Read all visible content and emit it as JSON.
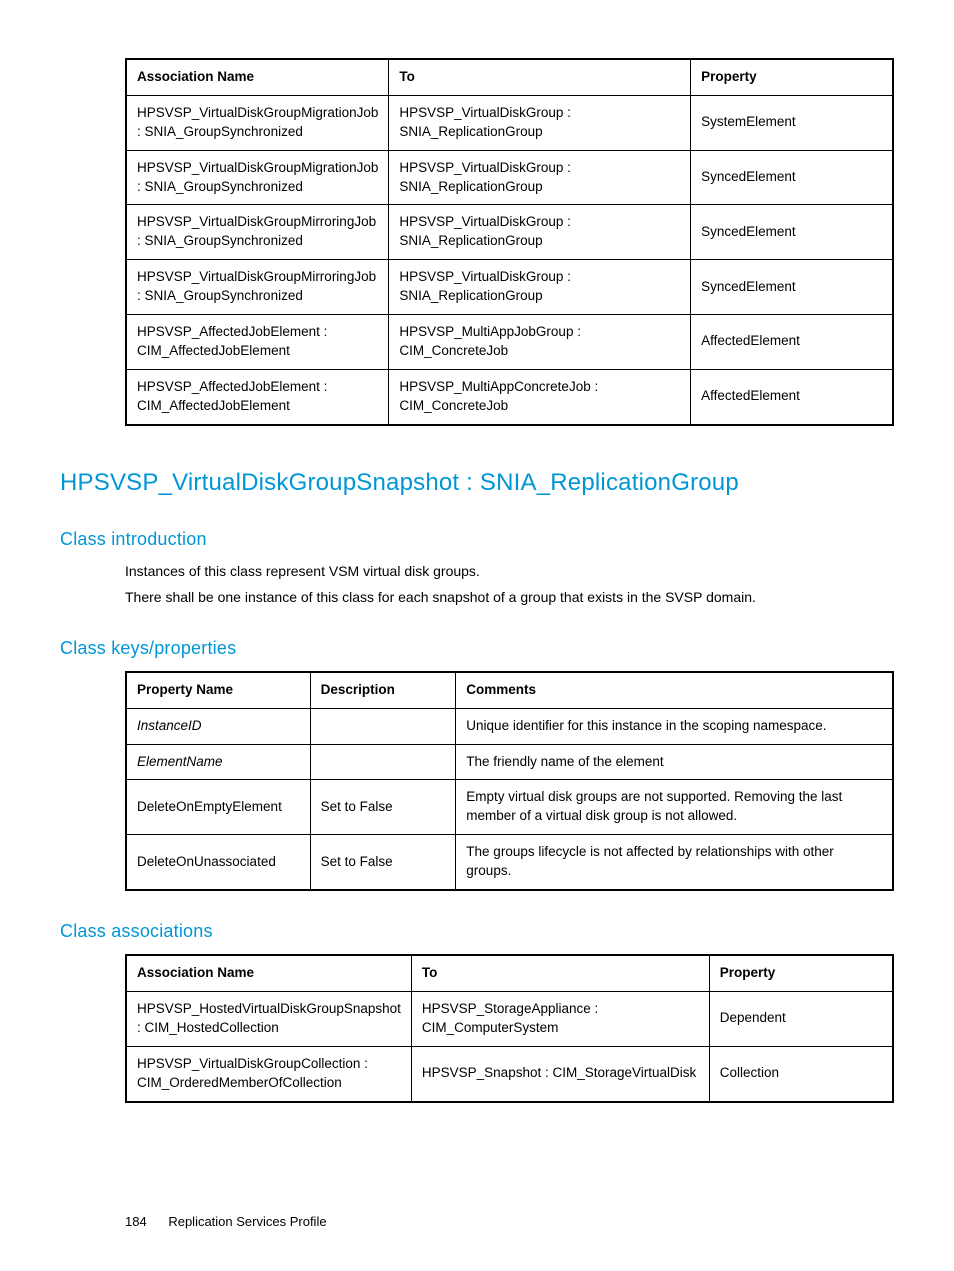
{
  "table1": {
    "headers": [
      "Association Name",
      "To",
      "Property"
    ],
    "rows": [
      [
        "HPSVSP_VirtualDiskGroupMigrationJob : SNIA_GroupSynchronized",
        "HPSVSP_VirtualDiskGroup : SNIA_ReplicationGroup",
        "SystemElement"
      ],
      [
        "HPSVSP_VirtualDiskGroupMigrationJob : SNIA_GroupSynchronized",
        "HPSVSP_VirtualDiskGroup : SNIA_ReplicationGroup",
        "SyncedElement"
      ],
      [
        "HPSVSP_VirtualDiskGroupMirroringJob : SNIA_GroupSynchronized",
        "HPSVSP_VirtualDiskGroup : SNIA_ReplicationGroup",
        "SyncedElement"
      ],
      [
        "HPSVSP_VirtualDiskGroupMirroringJob : SNIA_GroupSynchronized",
        "HPSVSP_VirtualDiskGroup : SNIA_ReplicationGroup",
        "SyncedElement"
      ],
      [
        "HPSVSP_AffectedJobElement : CIM_AffectedJobElement",
        "HPSVSP_MultiAppJobGroup : CIM_ConcreteJob",
        "AffectedElement"
      ],
      [
        "HPSVSP_AffectedJobElement : CIM_AffectedJobElement",
        "HPSVSP_MultiAppConcreteJob : CIM_ConcreteJob",
        "AffectedElement"
      ]
    ]
  },
  "heading1": "HPSVSP_VirtualDiskGroupSnapshot : SNIA_ReplicationGroup",
  "section_intro": {
    "title": "Class introduction",
    "p1": "Instances of this class represent VSM virtual disk groups.",
    "p2": "There shall be one instance of this class for each snapshot of a group that exists in the SVSP domain."
  },
  "section_keys": {
    "title": "Class keys/properties",
    "headers": [
      "Property Name",
      "Description",
      "Comments"
    ],
    "rows": [
      {
        "name": "InstanceID",
        "italic": true,
        "desc": "",
        "comments": "Unique identifier for this instance in the scoping namespace."
      },
      {
        "name": "ElementName",
        "italic": true,
        "desc": "",
        "comments": "The friendly name of the element"
      },
      {
        "name": "DeleteOnEmptyElement",
        "italic": false,
        "desc": "Set to False",
        "comments": "Empty virtual disk groups are not supported. Removing the last member of a virtual disk group is not allowed."
      },
      {
        "name": "DeleteOnUnassociated",
        "italic": false,
        "desc": "Set to False",
        "comments": "The groups lifecycle is not affected by relationships with other groups."
      }
    ]
  },
  "section_assoc": {
    "title": "Class associations",
    "headers": [
      "Association Name",
      "To",
      "Property"
    ],
    "rows": [
      [
        "HPSVSP_HostedVirtualDiskGroupSnapshot : CIM_HostedCollection",
        "HPSVSP_StorageAppliance : CIM_ComputerSystem",
        "Dependent"
      ],
      [
        "HPSVSP_VirtualDiskGroupCollection : CIM_OrderedMemberOfCollection",
        "HPSVSP_Snapshot : CIM_StorageVirtualDisk",
        "Collection"
      ]
    ]
  },
  "footer": {
    "page": "184",
    "title": "Replication Services Profile"
  }
}
